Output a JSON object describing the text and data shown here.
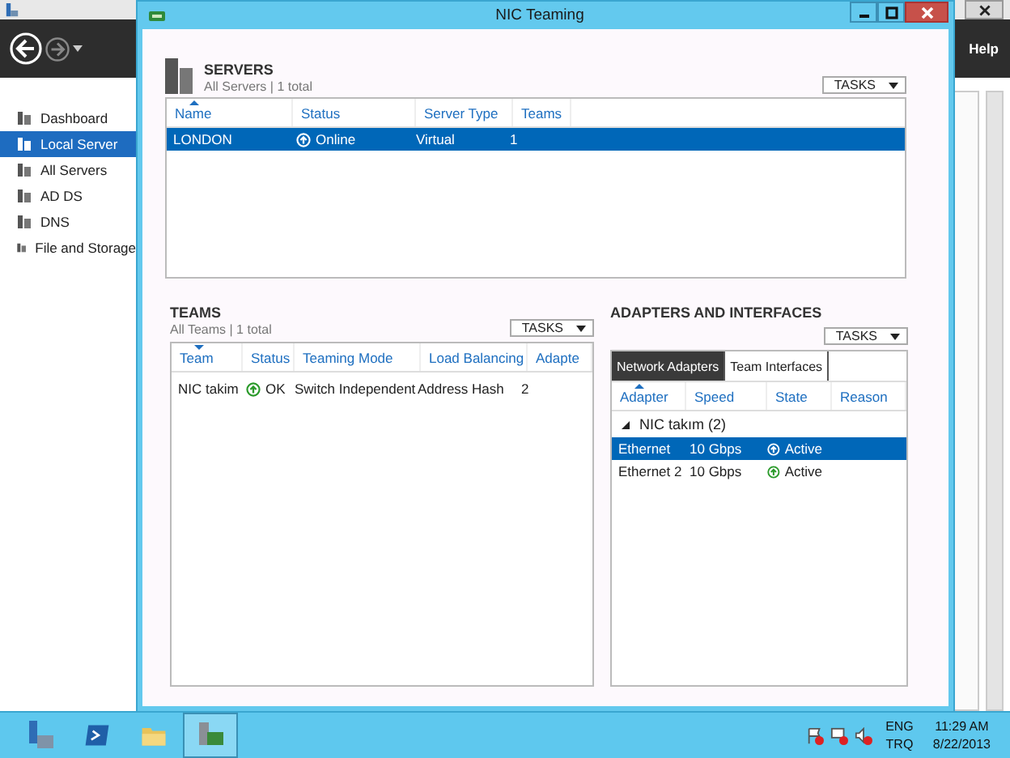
{
  "server_manager": {
    "menu": "Help",
    "nav": [
      {
        "label": "Dashboard",
        "selected": false
      },
      {
        "label": "Local Server",
        "selected": true
      },
      {
        "label": "All Servers",
        "selected": false
      },
      {
        "label": "AD DS",
        "selected": false
      },
      {
        "label": "DNS",
        "selected": false
      },
      {
        "label": "File and Storage",
        "selected": false
      }
    ]
  },
  "dialog": {
    "title": "NIC Teaming"
  },
  "servers": {
    "title": "SERVERS",
    "subtitle": "All Servers | 1 total",
    "tasks": "TASKS",
    "columns": [
      {
        "label": "Name",
        "sorted": true
      },
      {
        "label": "Status",
        "sorted": false
      },
      {
        "label": "Server Type",
        "sorted": false
      },
      {
        "label": "Teams",
        "sorted": false
      }
    ],
    "rows": [
      {
        "cells": [
          "LONDON",
          "Online",
          "Virtual",
          "1"
        ],
        "selected": true
      }
    ]
  },
  "teams": {
    "title": "TEAMS",
    "subtitle": "All Teams | 1 total",
    "tasks": "TASKS",
    "columns": [
      {
        "label": "Team",
        "sorted": true
      },
      {
        "label": "Status",
        "sorted": false
      },
      {
        "label": "Teaming Mode",
        "sorted": false
      },
      {
        "label": "Load Balancing",
        "sorted": false
      },
      {
        "label": "Adapte",
        "sorted": false
      }
    ],
    "rows": [
      {
        "cells": [
          "NIC takim",
          "OK",
          "Switch Independent",
          "Address Hash",
          "2"
        ],
        "selected": false
      }
    ]
  },
  "adapters": {
    "title": "ADAPTERS AND INTERFACES",
    "tasks": "TASKS",
    "tabs": [
      {
        "label": "Network Adapters",
        "selected": true
      },
      {
        "label": "Team Interfaces",
        "selected": false
      }
    ],
    "columns": [
      {
        "label": "Adapter",
        "sorted": true
      },
      {
        "label": "Speed",
        "sorted": false
      },
      {
        "label": "State",
        "sorted": false
      },
      {
        "label": "Reason",
        "sorted": false
      }
    ],
    "group": {
      "label": "NIC takım (2)",
      "expanded": true
    },
    "rows": [
      {
        "cells": [
          "Ethernet",
          "10 Gbps",
          "Active",
          ""
        ],
        "selected": true
      },
      {
        "cells": [
          "Ethernet 2",
          "10 Gbps",
          "Active",
          ""
        ],
        "selected": false
      }
    ]
  },
  "taskbar": {
    "apps": [
      {
        "kind": "server",
        "selected": false
      },
      {
        "kind": "shell",
        "selected": false
      },
      {
        "kind": "folder",
        "selected": false
      },
      {
        "kind": "nic",
        "selected": true
      }
    ],
    "language": "ENG",
    "keyboard": "TRQ",
    "time": "11:29 AM",
    "date": "8/22/2013"
  }
}
